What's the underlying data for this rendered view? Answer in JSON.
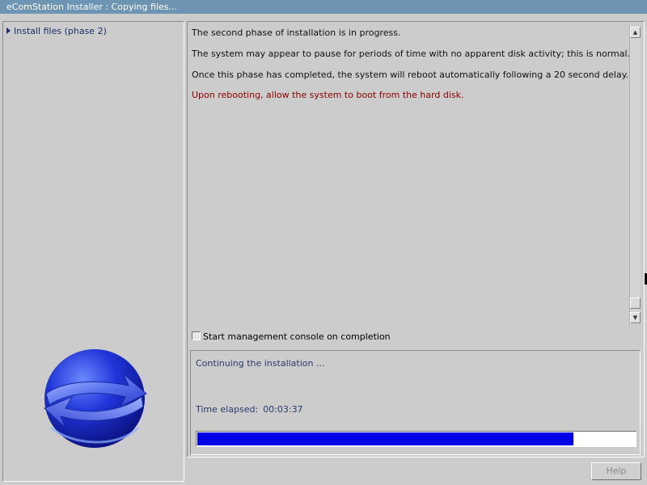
{
  "window": {
    "title": "eComStation Installer : Copying files..."
  },
  "sidebar": {
    "items": [
      {
        "label": "Install files (phase 2)",
        "icon": "triangle-right-icon"
      }
    ],
    "logo": "ecomstation-globe-logo"
  },
  "main": {
    "messages": [
      "The second phase of installation is in progress.",
      "The system may appear to pause for periods of time with no apparent disk activity; this is normal.",
      "Once this phase has completed, the system will reboot automatically following a 20 second delay.",
      "Upon rebooting, allow the system to boot from the hard disk."
    ],
    "warning_color": "#8b0000",
    "checkbox": {
      "label": "Start management console on completion",
      "checked": false
    },
    "status": {
      "text": "Continuing the installation ...",
      "elapsed_label": "Time elapsed:",
      "elapsed_value": "00:03:37",
      "progress_fraction": 0.86,
      "progress_color": "#0000e6"
    }
  },
  "footer": {
    "help_label": "Help"
  },
  "colors": {
    "titlebar": "#6e94b4",
    "background": "#cccccc"
  }
}
